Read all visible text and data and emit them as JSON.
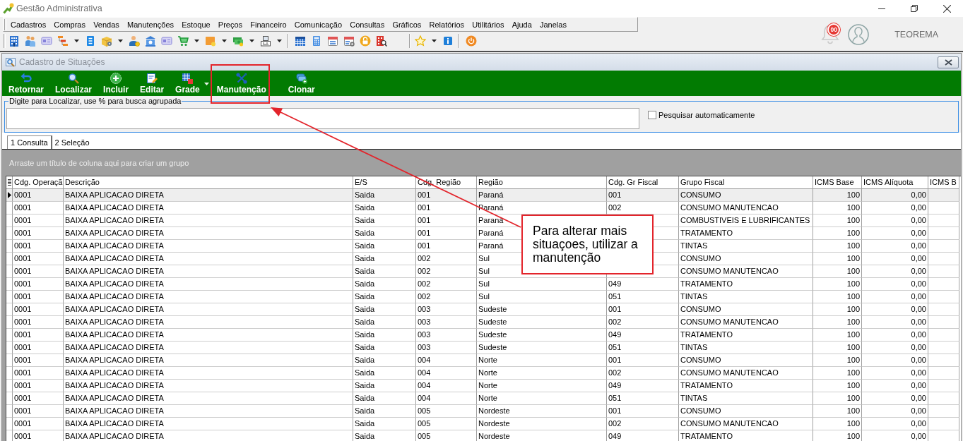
{
  "window": {
    "title": "Gestão Administrativa"
  },
  "menu": [
    "Cadastros",
    "Compras",
    "Vendas",
    "Manutenções",
    "Estoque",
    "Preços",
    "Financeiro",
    "Comunicação",
    "Consultas",
    "Gráficos",
    "Relatórios",
    "Utilitários",
    "Ajuda",
    "Janelas"
  ],
  "notifications": {
    "count": "00"
  },
  "user": {
    "name": "TEOREMA"
  },
  "form": {
    "title": "Cadastro de Situações",
    "actions": [
      {
        "kind": "return",
        "label": "Retornar",
        "dropdown": false,
        "highlighted": false
      },
      {
        "kind": "search",
        "label": "Localizar",
        "dropdown": false,
        "highlighted": false
      },
      {
        "kind": "add",
        "label": "Incluir",
        "dropdown": false,
        "highlighted": false
      },
      {
        "kind": "edit",
        "label": "Editar",
        "dropdown": false,
        "highlighted": false
      },
      {
        "kind": "grid",
        "label": "Grade",
        "dropdown": true,
        "highlighted": false
      },
      {
        "kind": "maintenance",
        "label": "Manutenção",
        "dropdown": false,
        "highlighted": true
      },
      {
        "kind": "clone",
        "label": "Clonar",
        "dropdown": false,
        "highlighted": false
      }
    ],
    "search": {
      "legend": "Digite para Localizar, use % para busca agrupada"
    },
    "auto_search": {
      "label": "Pesquisar automaticamente",
      "checked": false
    },
    "tabs": [
      {
        "label": "1 Consulta",
        "selected": true
      },
      {
        "label": "2 Seleção",
        "selected": false
      }
    ],
    "group_hint": "Arraste um título de coluna aqui para criar um grupo",
    "grid": {
      "columns": [
        {
          "label": "Cdg. Operaçã",
          "kind": "text"
        },
        {
          "label": "Descrição",
          "kind": "text"
        },
        {
          "label": "E/S",
          "kind": "text"
        },
        {
          "label": "Cdg. Região",
          "kind": "text"
        },
        {
          "label": "Região",
          "kind": "text"
        },
        {
          "label": "Cdg. Gr Fiscal",
          "kind": "text"
        },
        {
          "label": "Grupo Fiscal",
          "kind": "text"
        },
        {
          "label": "ICMS Base",
          "kind": "number"
        },
        {
          "label": "ICMS Alíquota",
          "kind": "number"
        },
        {
          "label": "ICMS B",
          "kind": "text"
        }
      ],
      "rows": [
        {
          "selected": true,
          "cells": [
            "0001",
            "BAIXA APLICACAO DIRETA",
            "Saida",
            "001",
            "Paraná",
            "001",
            "CONSUMO",
            "100",
            "0,00"
          ]
        },
        {
          "selected": false,
          "cells": [
            "0001",
            "BAIXA APLICACAO DIRETA",
            "Saida",
            "001",
            "Paraná",
            "002",
            "CONSUMO MANUTENCAO",
            "100",
            "0,00"
          ]
        },
        {
          "selected": false,
          "cells": [
            "0001",
            "BAIXA APLICACAO DIRETA",
            "Saida",
            "001",
            "Paraná",
            null,
            "COMBUSTIVEIS E LUBRIFICANTES",
            "100",
            "0,00"
          ]
        },
        {
          "selected": false,
          "cells": [
            "0001",
            "BAIXA APLICACAO DIRETA",
            "Saida",
            "001",
            "Paraná",
            null,
            "TRATAMENTO",
            "100",
            "0,00"
          ]
        },
        {
          "selected": false,
          "cells": [
            "0001",
            "BAIXA APLICACAO DIRETA",
            "Saida",
            "001",
            "Paraná",
            null,
            "TINTAS",
            "100",
            "0,00"
          ]
        },
        {
          "selected": false,
          "cells": [
            "0001",
            "BAIXA APLICACAO DIRETA",
            "Saida",
            "002",
            "Sul",
            null,
            "CONSUMO",
            "100",
            "0,00"
          ]
        },
        {
          "selected": false,
          "cells": [
            "0001",
            "BAIXA APLICACAO DIRETA",
            "Saida",
            "002",
            "Sul",
            null,
            "CONSUMO MANUTENCAO",
            "100",
            "0,00"
          ]
        },
        {
          "selected": false,
          "cells": [
            "0001",
            "BAIXA APLICACAO DIRETA",
            "Saida",
            "002",
            "Sul",
            "049",
            "TRATAMENTO",
            "100",
            "0,00"
          ]
        },
        {
          "selected": false,
          "cells": [
            "0001",
            "BAIXA APLICACAO DIRETA",
            "Saida",
            "002",
            "Sul",
            "051",
            "TINTAS",
            "100",
            "0,00"
          ]
        },
        {
          "selected": false,
          "cells": [
            "0001",
            "BAIXA APLICACAO DIRETA",
            "Saida",
            "003",
            "Sudeste",
            "001",
            "CONSUMO",
            "100",
            "0,00"
          ]
        },
        {
          "selected": false,
          "cells": [
            "0001",
            "BAIXA APLICACAO DIRETA",
            "Saida",
            "003",
            "Sudeste",
            "002",
            "CONSUMO MANUTENCAO",
            "100",
            "0,00"
          ]
        },
        {
          "selected": false,
          "cells": [
            "0001",
            "BAIXA APLICACAO DIRETA",
            "Saida",
            "003",
            "Sudeste",
            "049",
            "TRATAMENTO",
            "100",
            "0,00"
          ]
        },
        {
          "selected": false,
          "cells": [
            "0001",
            "BAIXA APLICACAO DIRETA",
            "Saida",
            "003",
            "Sudeste",
            "051",
            "TINTAS",
            "100",
            "0,00"
          ]
        },
        {
          "selected": false,
          "cells": [
            "0001",
            "BAIXA APLICACAO DIRETA",
            "Saida",
            "004",
            "Norte",
            "001",
            "CONSUMO",
            "100",
            "0,00"
          ]
        },
        {
          "selected": false,
          "cells": [
            "0001",
            "BAIXA APLICACAO DIRETA",
            "Saida",
            "004",
            "Norte",
            "002",
            "CONSUMO MANUTENCAO",
            "100",
            "0,00"
          ]
        },
        {
          "selected": false,
          "cells": [
            "0001",
            "BAIXA APLICACAO DIRETA",
            "Saida",
            "004",
            "Norte",
            "049",
            "TRATAMENTO",
            "100",
            "0,00"
          ]
        },
        {
          "selected": false,
          "cells": [
            "0001",
            "BAIXA APLICACAO DIRETA",
            "Saida",
            "004",
            "Norte",
            "051",
            "TINTAS",
            "100",
            "0,00"
          ]
        },
        {
          "selected": false,
          "cells": [
            "0001",
            "BAIXA APLICACAO DIRETA",
            "Saida",
            "005",
            "Nordeste",
            "001",
            "CONSUMO",
            "100",
            "0,00"
          ]
        },
        {
          "selected": false,
          "cells": [
            "0001",
            "BAIXA APLICACAO DIRETA",
            "Saida",
            "005",
            "Nordeste",
            "002",
            "CONSUMO MANUTENCAO",
            "100",
            "0,00"
          ]
        },
        {
          "selected": false,
          "cells": [
            "0001",
            "BAIXA APLICACAO DIRETA",
            "Saida",
            "005",
            "Nordeste",
            "049",
            "TRATAMENTO",
            "100",
            "0,00"
          ]
        }
      ]
    }
  },
  "annotation": {
    "text": "Para alterar mais situaçoes, utilizar a manutenção"
  }
}
